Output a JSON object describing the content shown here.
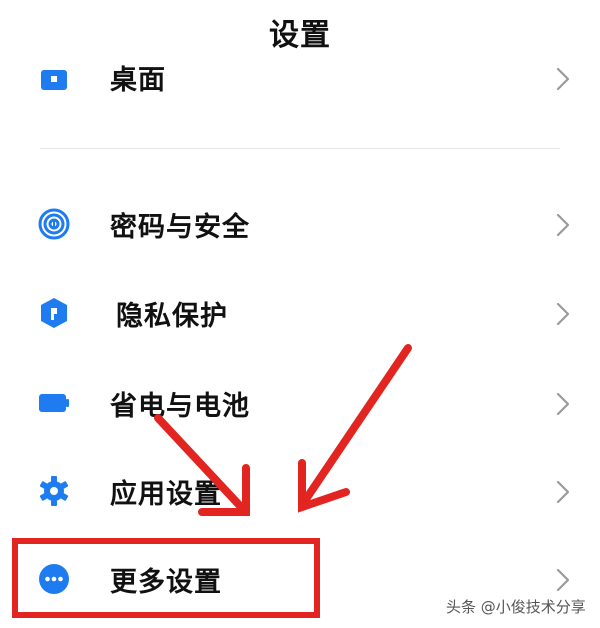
{
  "header": {
    "title": "设置"
  },
  "partial_row": {
    "label": "桌面",
    "icon": "desktop-icon"
  },
  "rows": [
    {
      "label": "密码与安全",
      "icon": "fingerprint-icon"
    },
    {
      "label": "隐私保护",
      "icon": "privacy-shield-icon"
    },
    {
      "label": "省电与电池",
      "icon": "battery-icon"
    },
    {
      "label": "应用设置",
      "icon": "gear-icon"
    },
    {
      "label": "更多设置",
      "icon": "more-icon"
    }
  ],
  "annotation": {
    "highlight_color": "#e32521",
    "target": "更多设置"
  },
  "watermark": "头条 @小俊技术分享",
  "colors": {
    "accent": "#1e7cf0",
    "chevron": "#9a9a9a",
    "annotation": "#e32521"
  }
}
